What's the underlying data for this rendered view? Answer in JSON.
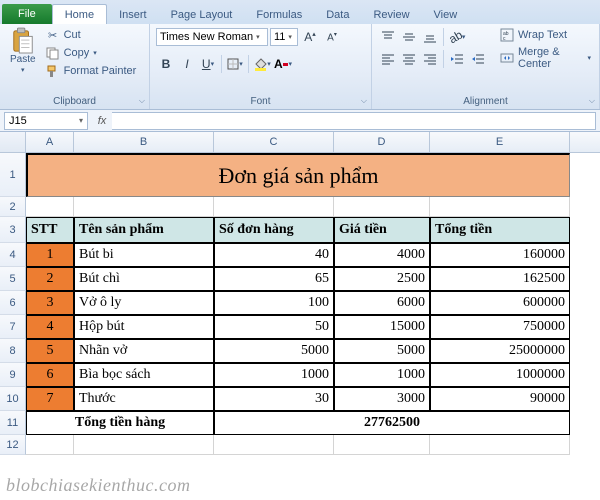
{
  "tabs": {
    "file": "File",
    "home": "Home",
    "insert": "Insert",
    "page_layout": "Page Layout",
    "formulas": "Formulas",
    "data": "Data",
    "review": "Review",
    "view": "View"
  },
  "groups": {
    "clipboard": "Clipboard",
    "font": "Font",
    "alignment": "Alignment"
  },
  "clipboard": {
    "paste": "Paste",
    "cut": "Cut",
    "copy": "Copy",
    "format_painter": "Format Painter"
  },
  "font": {
    "name": "Times New Roman",
    "size": "11"
  },
  "alignment": {
    "wrap": "Wrap Text",
    "merge": "Merge & Center"
  },
  "namebox": "J15",
  "fx": "fx",
  "cols": [
    "A",
    "B",
    "C",
    "D",
    "E"
  ],
  "rownums": [
    "1",
    "2",
    "3",
    "4",
    "5",
    "6",
    "7",
    "8",
    "9",
    "10",
    "11",
    "12"
  ],
  "title": "Đơn giá sản phẩm",
  "headers": {
    "stt": "STT",
    "name": "Tên sản phẩm",
    "orders": "Số đơn hàng",
    "price": "Giá tiền",
    "total": "Tổng tiền"
  },
  "items": [
    {
      "stt": "1",
      "name": "Bút bi",
      "orders": "40",
      "price": "4000",
      "total": "160000"
    },
    {
      "stt": "2",
      "name": "Bút chì",
      "orders": "65",
      "price": "2500",
      "total": "162500"
    },
    {
      "stt": "3",
      "name": "Vở ô ly",
      "orders": "100",
      "price": "6000",
      "total": "600000"
    },
    {
      "stt": "4",
      "name": "Hộp bút",
      "orders": "50",
      "price": "15000",
      "total": "750000"
    },
    {
      "stt": "5",
      "name": "Nhãn vở",
      "orders": "5000",
      "price": "5000",
      "total": "25000000"
    },
    {
      "stt": "6",
      "name": "Bìa bọc sách",
      "orders": "1000",
      "price": "1000",
      "total": "1000000"
    },
    {
      "stt": "7",
      "name": "Thước",
      "orders": "30",
      "price": "3000",
      "total": "90000"
    }
  ],
  "grand": {
    "label": "Tổng tiền hàng",
    "value": "27762500"
  },
  "watermark": "blobchiasekienthuc.com"
}
